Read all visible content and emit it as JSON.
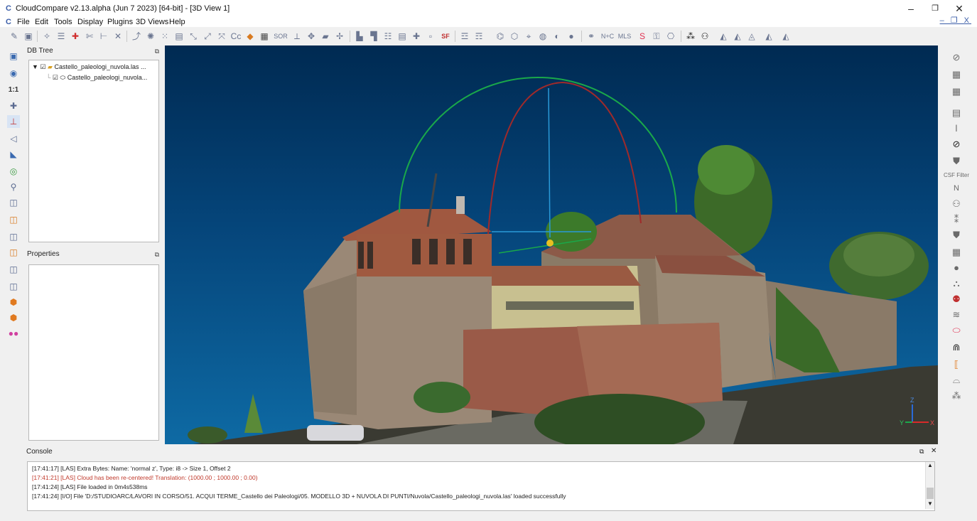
{
  "window": {
    "title": "CloudCompare v2.13.alpha (Jun  7 2023) [64-bit] - [3D View 1]",
    "app_icon": "cloudcompare-icon",
    "minimize": "–",
    "maximize": "❐",
    "close": "✕"
  },
  "menu": {
    "icon": "cloudcompare-icon",
    "items": [
      "File",
      "Edit",
      "Tools",
      "Display",
      "Plugins",
      "3D Views",
      "Help"
    ],
    "mdi_controls": "– ❐ X"
  },
  "toolbar": {
    "sor_label": "SOR",
    "sf_label": "SF",
    "nc_label": "N+C",
    "mls_label": "MLS"
  },
  "db_tree": {
    "title": "DB Tree",
    "items": [
      {
        "label": "Castello_paleologi_nuvola.las ...",
        "checked": true,
        "expanded": true
      },
      {
        "label": "Castello_paleologi_nuvola...",
        "checked": true
      }
    ]
  },
  "properties": {
    "title": "Properties"
  },
  "right_toolbar": {
    "csf_label": "CSF Filter",
    "n_label": "N"
  },
  "left_toolbar": {
    "zoom_label": "1:1"
  },
  "axes": {
    "z": "Z",
    "y": "Y",
    "x": "X"
  },
  "console": {
    "title": "Console",
    "lines": [
      {
        "text": "[17:41:17] [LAS] Extra Bytes: Name: 'normal z', Type: i8 -> Size 1, Offset 2",
        "error": false
      },
      {
        "text": "[17:41:21] [LAS] Cloud has been re-centered! Translation: (1000.00 ; 1000.00 ; 0.00)",
        "error": true
      },
      {
        "text": "[17:41:24] [LAS] File loaded in 0m4s538ms",
        "error": false
      },
      {
        "text": "[17:41:24] [I/O] File 'D:/STUDIOARC/LAVORI IN CORSO/51. ACQUI TERME_Castello dei Paleologi/05. MODELLO 3D + NUVOLA DI PUNTI/Nuvola/Castello_paleologi_nuvola.las' loaded successfully",
        "error": false
      }
    ]
  },
  "colors": {
    "view_top": "#002a52",
    "view_bottom": "#0e6aa4",
    "error_text": "#c0392b"
  }
}
